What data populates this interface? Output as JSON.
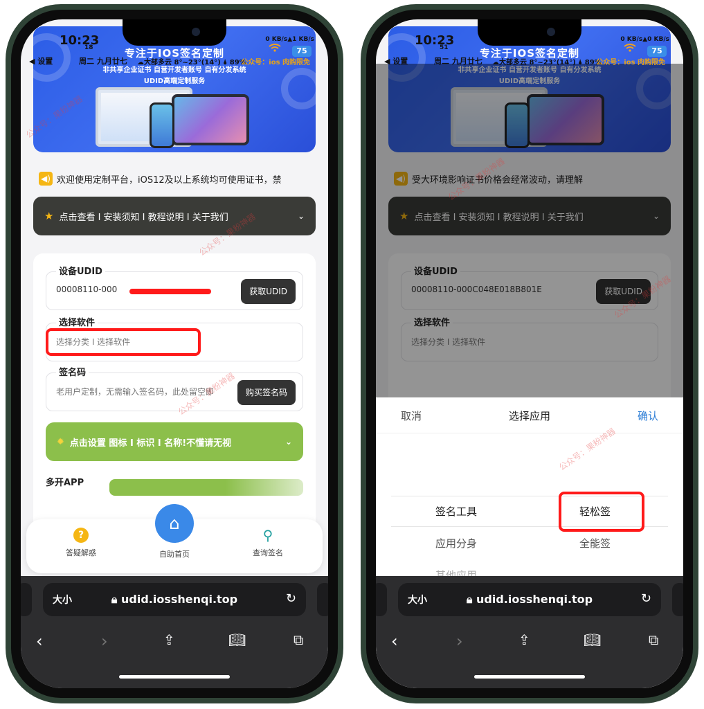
{
  "left": {
    "status": {
      "time": "10:23",
      "seconds": "18",
      "back": "◀ 设置",
      "date": "周二 九月廿七",
      "net": "0 KB/s▲1 KB/s",
      "weather": "☁大部多云 8°~23°(14°) 🌢 89%",
      "official": "公众号：ios 肉购限免",
      "battery": "75"
    },
    "banner": {
      "title": "专注于IOS签名定制",
      "line1": "非共享企业证书 自营开发者账号 自有分发系统",
      "line2": "UDID高端定制服务"
    },
    "notice": "欢迎使用定制平台，iOS12及以上系统均可使用证书，禁",
    "dark_bar": "点击查看 I 安装须知 I 教程说明 I 关于我们",
    "udid": {
      "label": "设备UDID",
      "value": "00008110-000",
      "button": "获取UDID"
    },
    "software": {
      "label": "选择软件",
      "placeholder": "选择分类 I 选择软件"
    },
    "sign_code": {
      "label": "签名码",
      "placeholder": "老用户定制，无需输入签名码，此处留空即",
      "button": "购买签名码"
    },
    "green_bar": "点击设置 图标 I 标识 I 名称!不懂请无视",
    "multi_app": "多开APP",
    "tabbar": {
      "help": "答疑解惑",
      "home": "自助首页",
      "query": "查询签名"
    },
    "browser": {
      "size": "大小",
      "url": "udid.iosshenqi.top"
    }
  },
  "right": {
    "status": {
      "time": "10:23",
      "seconds": "51",
      "back": "◀ 设置",
      "date": "周二 九月廿七",
      "net": "0 KB/s▲0 KB/s",
      "weather": "☁大部多云 8°~23°(14°) 🌢 89%",
      "official": "公众号：ios 肉购限免",
      "battery": "75"
    },
    "banner": {
      "title": "专注于IOS签名定制",
      "line1": "非共享企业证书 自营开发者账号 自有分发系统",
      "line2": "UDID高端定制服务"
    },
    "notice": "受大环境影响证书价格会经常波动，请理解",
    "dark_bar": "点击查看 I 安装须知 I 教程说明 I 关于我们",
    "udid": {
      "label": "设备UDID",
      "value": "00008110-000C048E018B801E",
      "button": "获取UDID"
    },
    "software": {
      "label": "选择软件",
      "placeholder": "选择分类 I 选择软件"
    },
    "sheet": {
      "cancel": "取消",
      "title": "选择应用",
      "confirm": "确认",
      "left_col": [
        "签名工具",
        "应用分身",
        "其他应用"
      ],
      "right_col": [
        "轻松签",
        "全能签"
      ]
    },
    "browser": {
      "size": "大小",
      "url": "udid.iosshenqi.top"
    }
  },
  "watermark": "公众号：果粉神器",
  "colors": {
    "accent": "#3a89e8",
    "highlight": "#ff1a1a",
    "green": "#8cbf4b",
    "frame": "#2f4336"
  }
}
